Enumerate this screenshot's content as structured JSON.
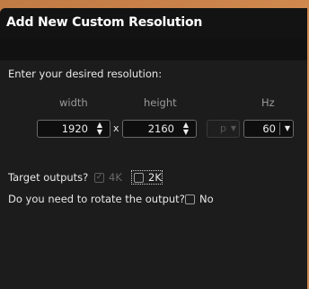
{
  "dialog": {
    "title": "Add New Custom Resolution"
  },
  "resolution": {
    "prompt": "Enter your desired resolution:",
    "width_label": "width",
    "height_label": "height",
    "hz_label": "Hz",
    "width_value": "1920",
    "height_value": "2160",
    "separator": "x",
    "scan_value": "p",
    "hz_value": "60"
  },
  "outputs": {
    "label": "Target outputs?",
    "option_4k": {
      "label": "4K",
      "checked": true,
      "disabled": true
    },
    "option_2k": {
      "label": "2K",
      "checked": false,
      "disabled": false
    }
  },
  "rotate": {
    "question": "Do you need to rotate the output?",
    "option_label": "No",
    "checked": false
  },
  "icons": {
    "spin_arrows": "up-down-arrows-icon",
    "dropdown": "chevron-down-icon",
    "checkmark": "check-icon"
  }
}
